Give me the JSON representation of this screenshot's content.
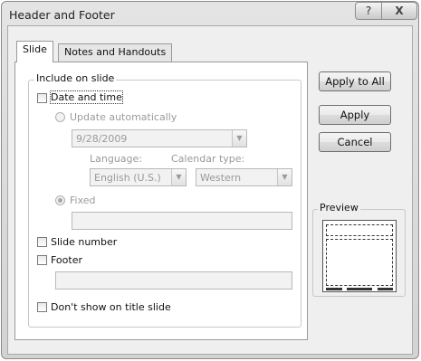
{
  "dialog": {
    "title": "Header and Footer",
    "help_glyph": "?",
    "close_glyph": "X"
  },
  "tabs": [
    {
      "label": "Slide",
      "active": true
    },
    {
      "label": "Notes and Handouts",
      "active": false
    }
  ],
  "include_group": {
    "legend": "Include on slide"
  },
  "date_time": {
    "label": "Date and time",
    "checked": false,
    "update_auto_label": "Update automatically",
    "date_value": "9/28/2009",
    "language_label": "Language:",
    "language_value": "English (U.S.)",
    "calendar_label": "Calendar type:",
    "calendar_value": "Western",
    "fixed_label": "Fixed",
    "fixed_value": ""
  },
  "slide_number": {
    "label": "Slide number",
    "checked": false
  },
  "footer": {
    "label": "Footer",
    "checked": false,
    "value": ""
  },
  "dont_show_title": {
    "label": "Don't show on title slide",
    "checked": false
  },
  "buttons": {
    "apply_all": "Apply to All",
    "apply": "Apply",
    "cancel": "Cancel"
  },
  "preview": {
    "legend": "Preview"
  },
  "icons": {
    "dropdown": "chevron-down-icon",
    "help": "help-icon",
    "close": "close-icon"
  }
}
